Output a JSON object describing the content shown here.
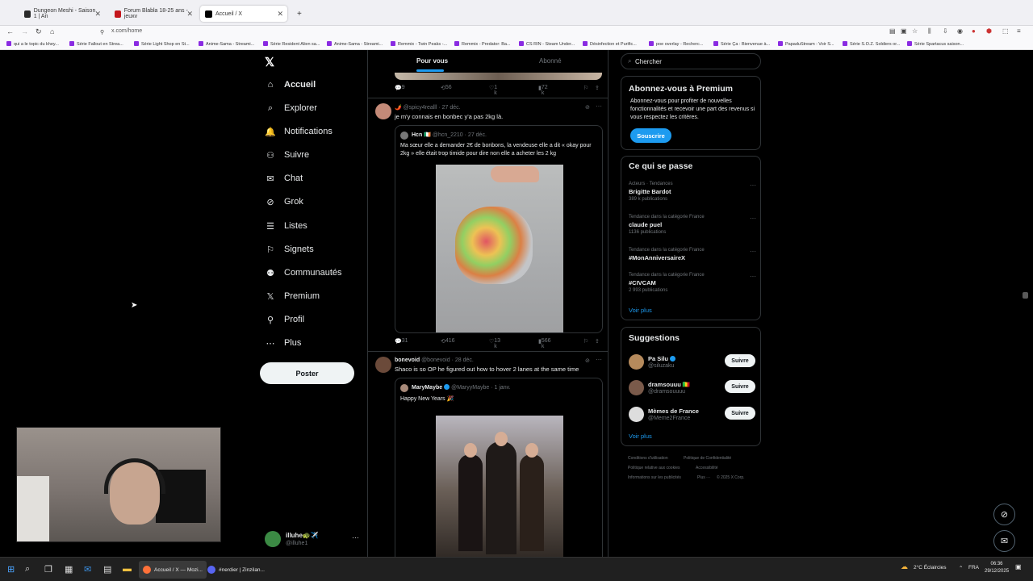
{
  "browser": {
    "tabs": [
      {
        "title": "Dungeon Meshi - Saison 1 | An"
      },
      {
        "title": "Forum Blabla 18-25 ans - jeuxv"
      },
      {
        "title": "Accueil / X"
      }
    ],
    "new_tab": "+",
    "url": "x.com/home",
    "bookmarks": [
      "qui a le topic du khey...",
      "Série Fallout en Strea...",
      "Série Light Shop en St...",
      "Anime-Sama - Streami...",
      "Série Resident Alien sa...",
      "Anime-Sama - Streami...",
      "Remmix - Twin Peaks -...",
      "Remmix - Predator: Ba...",
      "CS RIN - Steam Under...",
      "Désinfection et Purific...",
      "poe overlay - Recherc...",
      "Série Ça : Bienvenue à...",
      "PapaduStream : Voir S...",
      "Série S.O.Z. Soldiers or...",
      "Série Spartacus saison..."
    ]
  },
  "sidebar": {
    "logo": "𝕏",
    "items": [
      {
        "label": "Accueil",
        "icon": "⌂"
      },
      {
        "label": "Explorer",
        "icon": "⌕"
      },
      {
        "label": "Notifications",
        "icon": "🔔"
      },
      {
        "label": "Suivre",
        "icon": "⚇"
      },
      {
        "label": "Chat",
        "icon": "✉"
      },
      {
        "label": "Grok",
        "icon": "⊘"
      },
      {
        "label": "Listes",
        "icon": "☰"
      },
      {
        "label": "Signets",
        "icon": "⚐"
      },
      {
        "label": "Communautés",
        "icon": "⚉"
      },
      {
        "label": "Premium",
        "icon": "𝕏"
      },
      {
        "label": "Profil",
        "icon": "⚲"
      },
      {
        "label": "Plus",
        "icon": "⋯"
      }
    ],
    "post_button": "Poster",
    "account": {
      "name": "illuhe🐢✈️",
      "handle": "@illuhe1",
      "more": "···"
    }
  },
  "feed": {
    "tabs": [
      "Pour vous",
      "Abonné"
    ],
    "top_actions": {
      "replies": "9",
      "reposts": "56",
      "likes": "1 k",
      "views": "72 k"
    },
    "tweets": [
      {
        "author": "🌶️",
        "handle": "@spicy4realll",
        "date": "· 27 déc.",
        "text": "je m'y connais en bonbec y'a pas 2kg là.",
        "quote": {
          "author": "Hcn 🇮🇪",
          "handle": "@hcn_2210",
          "date": "· 27 déc.",
          "text": "Ma sœur elle a demander 2€ de bonbons, la vendeuse elle a dit « okay pour 2kg » elle était trop timide pour dire non elle a acheter les 2 kg"
        },
        "actions": {
          "replies": "31",
          "reposts": "416",
          "likes": "13 k",
          "views": "566 k"
        }
      },
      {
        "author": "bonevoid",
        "handle": "@bonevoid",
        "date": "· 28 déc.",
        "text": "Shaco is so OP he figured out how to hover 2 lanes at the same time",
        "quote": {
          "author": "MaryMaybe",
          "handle": "@MaryyMaybe",
          "date": "· 1 janv.",
          "text": "Happy New Years 🎉"
        }
      }
    ]
  },
  "right": {
    "search_placeholder": "Chercher",
    "premium": {
      "title": "Abonnez-vous à Premium",
      "text": "Abonnez-vous pour profiter de nouvelles fonctionnalités et recevoir une part des revenus si vous respectez les critères.",
      "button": "Souscrire"
    },
    "trends": {
      "title": "Ce qui se passe",
      "items": [
        {
          "category": "Acteurs · Tendances",
          "name": "Brigitte Bardot",
          "count": "389 k publications"
        },
        {
          "category": "Tendance dans la catégorie France",
          "name": "claude puel",
          "count": "1136 publications"
        },
        {
          "category": "Tendance dans la catégorie France",
          "name": "#MonAnniversaireX",
          "count": ""
        },
        {
          "category": "Tendance dans la catégorie France",
          "name": "#CIVCAM",
          "count": "2 993 publications"
        }
      ],
      "more": "Voir plus"
    },
    "suggestions": {
      "title": "Suggestions",
      "items": [
        {
          "name": "Pa Silu",
          "handle": "@siluzaku",
          "button": "Suivre"
        },
        {
          "name": "dramsouuu 🇲🇱",
          "handle": "@dramsouuuu",
          "button": "Suivre"
        },
        {
          "name": "Mèmes de France",
          "handle": "@Meme2France",
          "button": "Suivre"
        }
      ],
      "more": "Voir plus"
    },
    "footer": [
      "Conditions d'utilisation",
      "Politique de Confidentialité",
      "Politique relative aux cookies",
      "Accessibilité",
      "Informations sur les publicités",
      "Plus ···",
      "© 2025 X Corp."
    ]
  },
  "taskbar": {
    "apps": [
      "Accueil / X — Mozi...",
      "#nerdier | Zinzilan..."
    ],
    "weather": "2°C  Éclaircies",
    "lang": "FRA",
    "time": "06:36",
    "date": "29/12/2025"
  },
  "colors": {
    "accent": "#1d9bf0",
    "background": "#000000",
    "text": "#e7e9ea",
    "muted": "#71767b"
  }
}
